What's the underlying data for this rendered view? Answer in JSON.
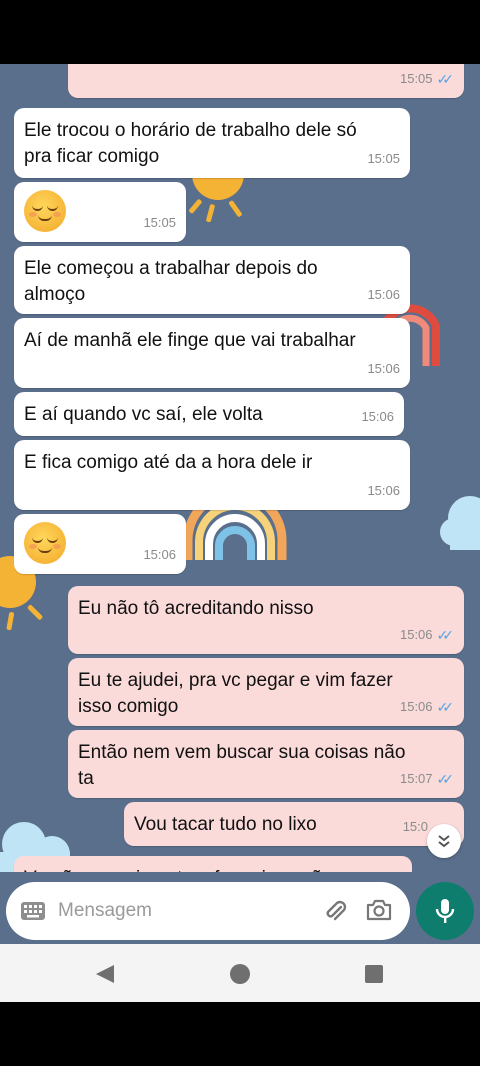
{
  "messages": [
    {
      "dir": "out",
      "text": "",
      "time": "15:05",
      "ticks": true
    },
    {
      "dir": "in",
      "text": "Ele trocou o horário de trabalho dele só\npra ficar comigo",
      "time": "15:05"
    },
    {
      "dir": "in",
      "emoji": "relieved-face",
      "time": "15:05"
    },
    {
      "dir": "in",
      "text": "Ele começou a trabalhar depois do\nalmoço",
      "time": "15:06"
    },
    {
      "dir": "in",
      "text": "Aí de manhã ele finge que vai trabalhar",
      "time": "15:06"
    },
    {
      "dir": "in",
      "text": "E aí quando vc saí, ele volta",
      "time": "15:06"
    },
    {
      "dir": "in",
      "text": "E fica comigo até da a hora dele ir",
      "time": "15:06"
    },
    {
      "dir": "in",
      "emoji": "relieved-face",
      "time": "15:06"
    },
    {
      "dir": "out",
      "text": "Eu não tô acreditando nisso",
      "time": "15:06",
      "ticks": true
    },
    {
      "dir": "out",
      "text": "Eu te ajudei, pra vc pegar e vim fazer\nisso comigo",
      "time": "15:06",
      "ticks": true
    },
    {
      "dir": "out",
      "text": "Então nem vem buscar sua coisas não\nta",
      "time": "15:07",
      "ticks": true
    },
    {
      "dir": "out",
      "text": "Vou tacar tudo no lixo",
      "time": "15:0"
    },
    {
      "dir": "out",
      "text": "Vc não experimente a fazer isso não",
      "time": ""
    }
  ],
  "composer": {
    "placeholder": "Mensagem",
    "keyboard_icon": "keyboard-icon",
    "attach_icon": "paperclip-icon",
    "camera_icon": "camera-icon",
    "mic_icon": "microphone-icon"
  },
  "navbar": {
    "back": "back-triangle-icon",
    "home": "home-circle-icon",
    "recents": "recents-square-icon"
  },
  "colors": {
    "wallpaper": "#5a6f8c",
    "incoming": "#ffffff",
    "outgoing": "#fbdada",
    "read_ticks": "#4fa6e8",
    "mic_button": "#0e7d6d"
  }
}
